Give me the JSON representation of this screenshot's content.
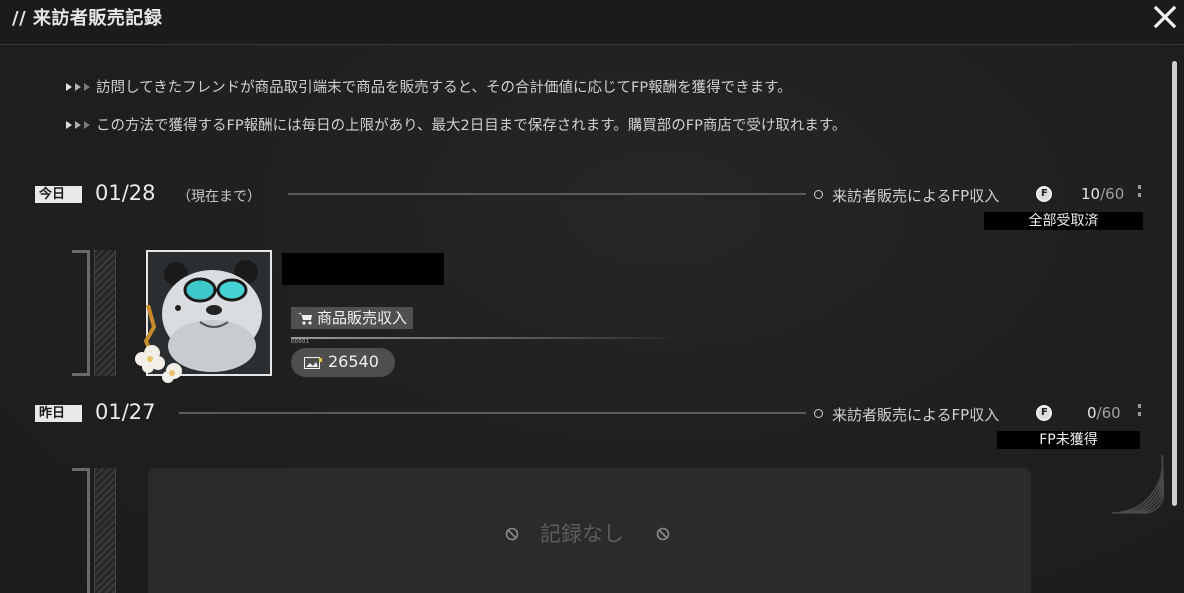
{
  "window": {
    "title": "// 来訪者販売記録",
    "close_icon": "close-icon"
  },
  "notes": [
    "訪問してきたフレンドが商品取引端末で商品を販売すると、その合計価値に応じてFP報酬を獲得できます。",
    "この方法で獲得するFP報酬には毎日の上限があり、最大2日目まで保存されます。購買部のFP商店で受け取れます。"
  ],
  "days": [
    {
      "tag": "今日",
      "date": "01/28",
      "sub": "（現在まで）",
      "fp_label": "来訪者販売によるFP収入",
      "fp_coin": "F",
      "fp_current": "10",
      "fp_cap": "/60",
      "status": "全部受取済",
      "entries": [
        {
          "name": "",
          "type_label": "商品販売収入",
          "bar_tick": "00001",
          "value": "26540"
        }
      ]
    },
    {
      "tag": "昨日",
      "date": "01/27",
      "fp_label": "来訪者販売によるFP収入",
      "fp_coin": "F",
      "fp_current": "0",
      "fp_cap": "/60",
      "status": "FP未獲得",
      "empty_text": "記録なし"
    }
  ],
  "colors": {
    "background": "#1f1f1f",
    "text": "#d8d8d8",
    "chip": "#505050",
    "status_chip": "#000000"
  }
}
